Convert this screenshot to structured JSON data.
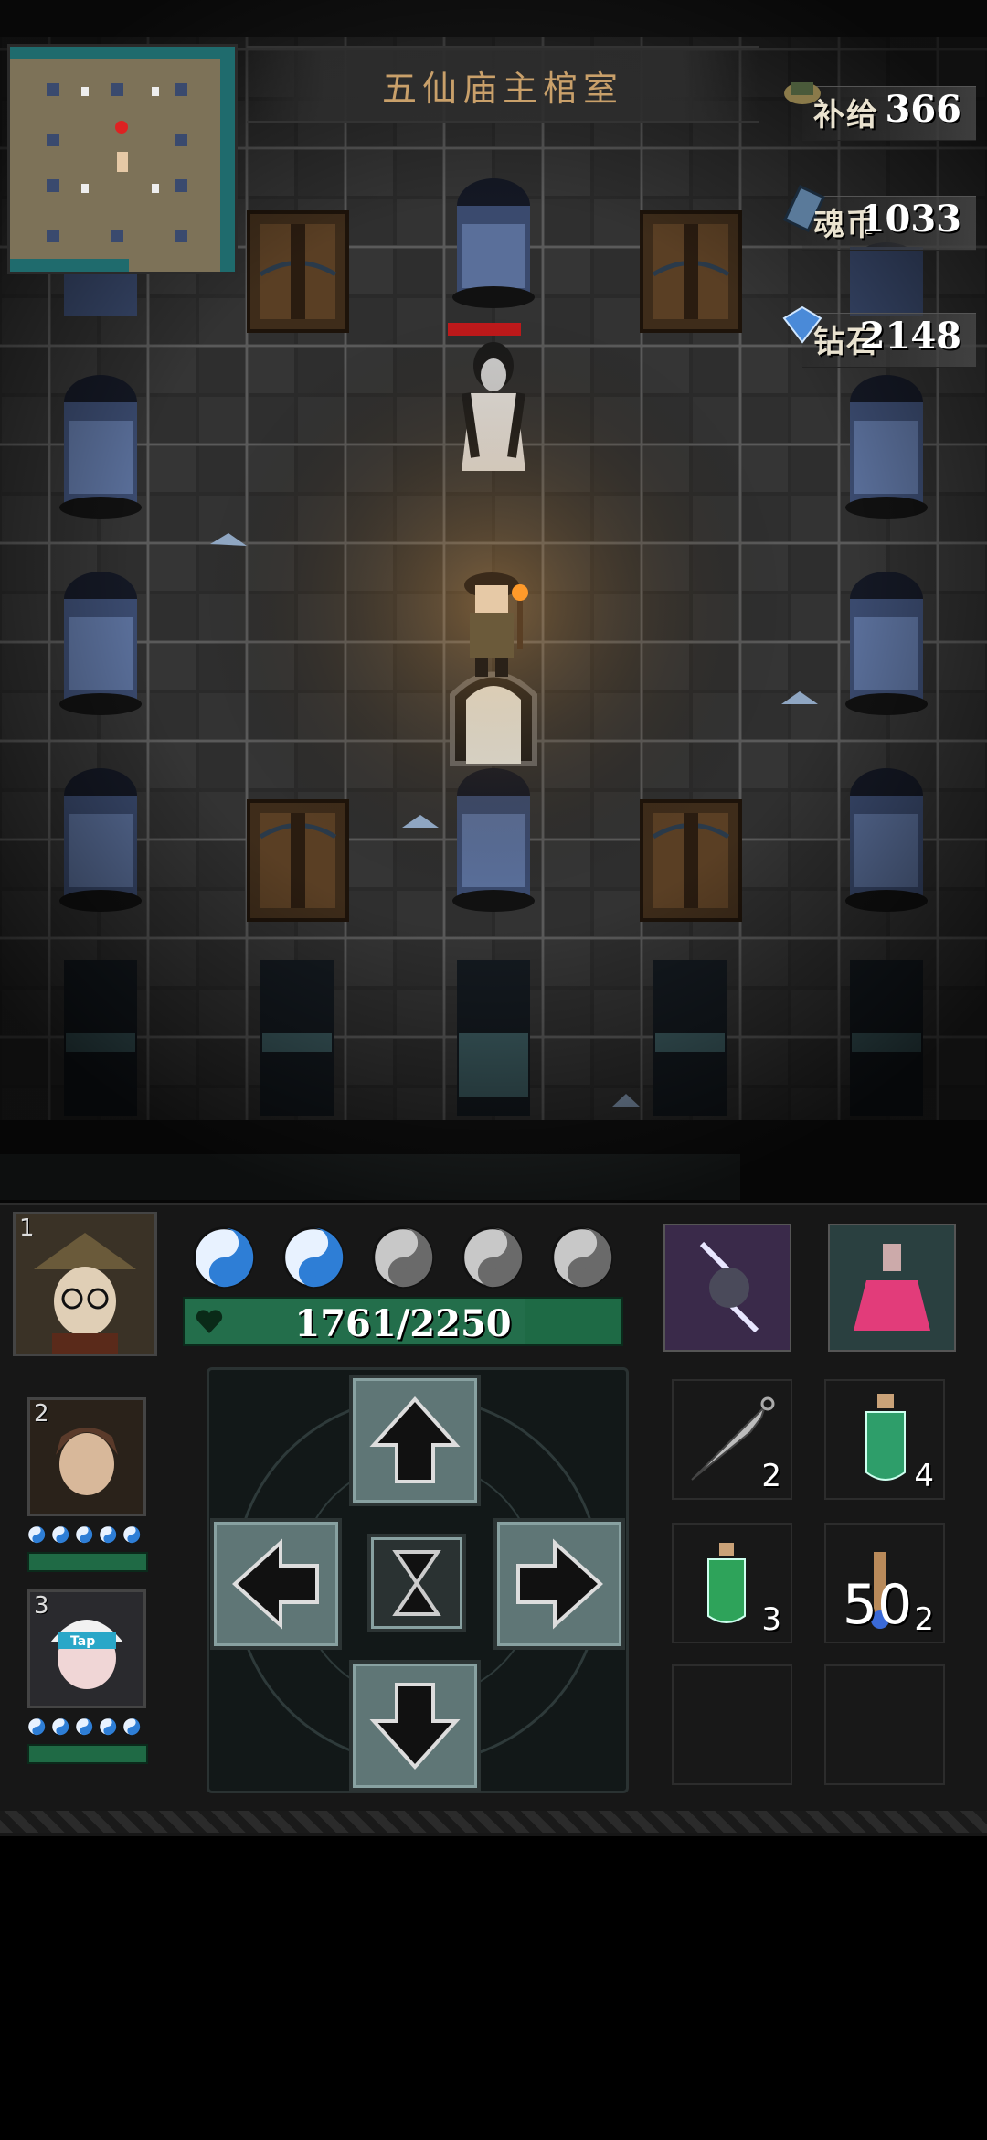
{
  "title": "五仙庙主棺室",
  "resources": [
    {
      "label": "补给",
      "value": "366",
      "icon": "supply-icon"
    },
    {
      "label": "魂币",
      "value": "1033",
      "icon": "soul-coin-icon"
    },
    {
      "label": "钻石",
      "value": "2148",
      "icon": "diamond-icon"
    }
  ],
  "party": {
    "leader_index": "1",
    "members": [
      {
        "index": "2"
      },
      {
        "index": "3",
        "badge": "Tap"
      }
    ]
  },
  "hp": {
    "text": "1761/2250",
    "fraction": 0.78
  },
  "energy": {
    "filled": 2,
    "total": 5
  },
  "skills": [
    {
      "name": "lightning-skill-icon"
    },
    {
      "name": "potion-skill-icon"
    }
  ],
  "inventory": [
    {
      "name": "kunai",
      "count": "2"
    },
    {
      "name": "green-potion",
      "count": "4"
    },
    {
      "name": "green-potion-small",
      "count": "3"
    },
    {
      "name": "blue-vial",
      "count": "2"
    },
    {
      "name": "empty",
      "count": ""
    },
    {
      "name": "empty",
      "count": ""
    }
  ],
  "overlay_number": "50",
  "colors": {
    "hp_green": "#1e6a45",
    "accent_teal": "#5f7676",
    "title_gold": "#c9a06a",
    "enemy_hp_red": "#c0191b"
  }
}
